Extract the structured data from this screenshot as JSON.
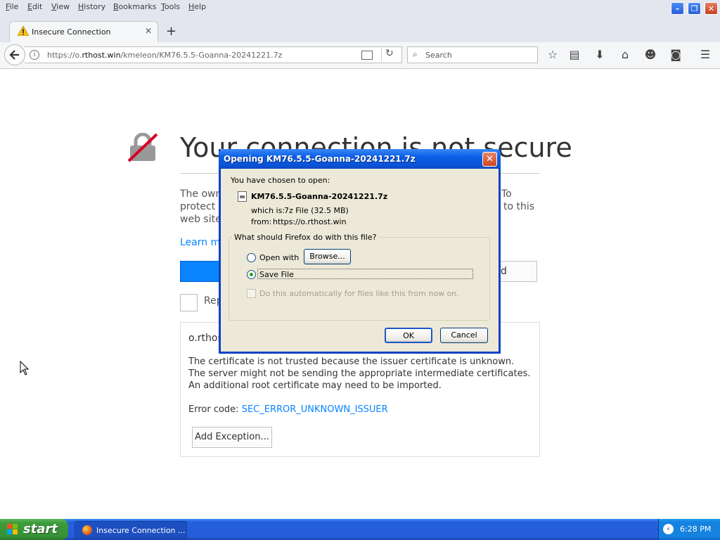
{
  "menubar": {
    "items": [
      "File",
      "Edit",
      "View",
      "History",
      "Bookmarks",
      "Tools",
      "Help"
    ],
    "accel": [
      "F",
      "E",
      "V",
      "H",
      "B",
      "T",
      "H"
    ],
    "rest": [
      "ile",
      "dit",
      "iew",
      "istory",
      "ookmarks",
      "ools",
      "elp"
    ]
  },
  "tab": {
    "title": "Insecure Connection",
    "close": "✕",
    "new": "+"
  },
  "navbar": {
    "url_prefix": "https://o.",
    "url_domain": "rthost.win",
    "url_path": "/kmeleon/KM76.5.5-Goanna-20241221.7z",
    "search_placeholder": "Search"
  },
  "page": {
    "title": "Your connection is not secure",
    "para_line1_left": "The own",
    "para_line1_right": "To",
    "para_line2_left": "protect y",
    "para_line2_right": "to this",
    "para_line3_left": "web site",
    "learn_more": "Learn m",
    "advanced_partial": "d",
    "report_partial": "Rep",
    "host_partial": "o.rthos",
    "msg1": "The certificate is not trusted because the issuer certificate is unknown.",
    "msg2": "The server might not be sending the appropriate intermediate certificates.",
    "msg3": "An additional root certificate may need to be imported.",
    "error_code_label": "Error code: ",
    "error_code": "SEC_ERROR_UNKNOWN_ISSUER",
    "add_exception": "Add Exception..."
  },
  "dialog": {
    "title": "Opening KM76.5.5-Goanna-20241221.7z",
    "close": "✕",
    "chosen": "You have chosen to open:",
    "filename": "KM76.5.5-Goanna-20241221.7z",
    "which_is_label": "which is:",
    "which_is_value": "7z File (32.5 MB)",
    "from_label": "from:",
    "from_value": "https://o.rthost.win",
    "question": "What should Firefox do with this file?",
    "open_with": "Open with",
    "browse": "Browse...",
    "save_file": "Save File",
    "auto": "Do this automatically for files like this from now on.",
    "ok": "OK",
    "cancel": "Cancel",
    "selected_option": "Save File"
  },
  "taskbar": {
    "start": "start",
    "task": "Insecure Connection ...",
    "clock": "6:28 PM",
    "tray_arrow": "‹"
  }
}
